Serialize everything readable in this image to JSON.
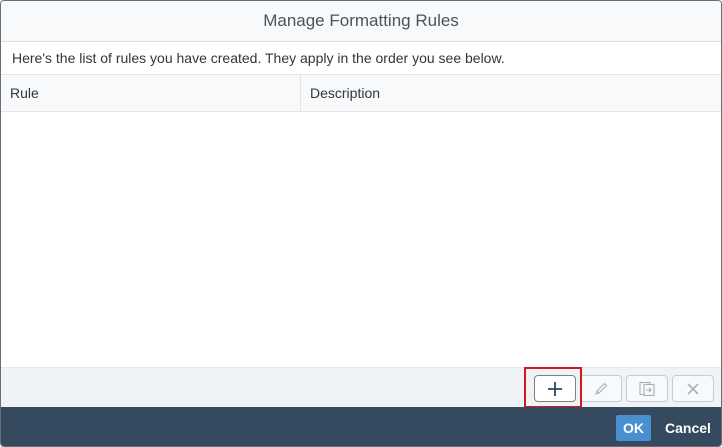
{
  "dialog": {
    "title": "Manage Formatting Rules",
    "intro": "Here's the list of rules you have created. They apply in the order you see below."
  },
  "table": {
    "columns": [
      "Rule",
      "Description"
    ],
    "rows": []
  },
  "toolbar": {
    "buttons": [
      {
        "name": "add",
        "icon": "plus-icon",
        "enabled": true,
        "highlighted": true
      },
      {
        "name": "edit",
        "icon": "pencil-icon",
        "enabled": false
      },
      {
        "name": "duplicate",
        "icon": "duplicate-icon",
        "enabled": false
      },
      {
        "name": "delete",
        "icon": "close-icon",
        "enabled": false
      }
    ]
  },
  "footer": {
    "ok_label": "OK",
    "cancel_label": "Cancel"
  },
  "colors": {
    "footer_bg": "#354a5f",
    "ok_button": "#4a8fcf",
    "highlight": "#d2171e"
  }
}
